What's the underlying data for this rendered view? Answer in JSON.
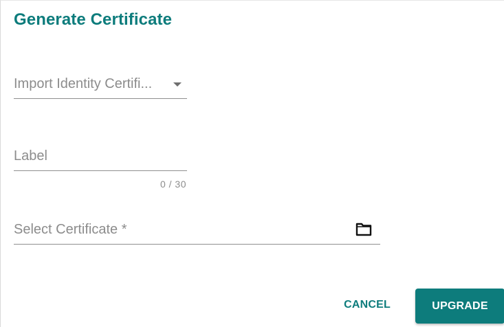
{
  "dialog": {
    "title": "Generate Certificate",
    "accent_color": "#0d7c7c"
  },
  "fields": {
    "import_select": {
      "value": "Import Identity Certifi...",
      "icon": "dropdown-arrow-icon"
    },
    "label_input": {
      "placeholder": "Label",
      "counter": "0 / 30"
    },
    "certificate_input": {
      "placeholder": "Select Certificate *",
      "icon": "folder-icon"
    }
  },
  "actions": {
    "cancel_label": "CANCEL",
    "upgrade_label": "UPGRADE"
  }
}
